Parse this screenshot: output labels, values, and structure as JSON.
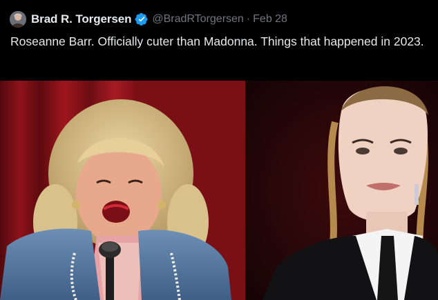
{
  "tweet": {
    "author_name": "Brad R. Torgersen",
    "author_handle": "@BradRTorgersen",
    "separator": "·",
    "date": "Feb 28",
    "text": "Roseanne Barr. Officially cuter than Madonna. Things that happened in 2023.",
    "verified": true
  },
  "icons": {
    "avatar": "user-avatar",
    "verified": "verified-badge-icon"
  },
  "colors": {
    "background": "#000000",
    "text_primary": "#e7e9ea",
    "text_secondary": "#71767b",
    "verified_blue": "#1d9bf0",
    "curtain_red": "#a3161e"
  }
}
